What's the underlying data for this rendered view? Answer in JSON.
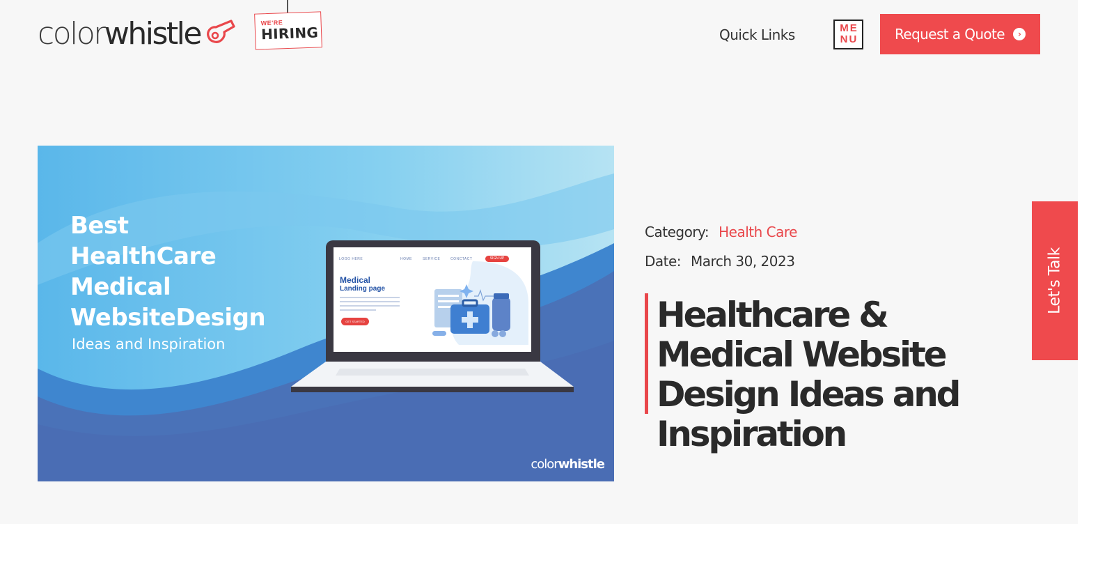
{
  "header": {
    "logo_light": "color",
    "logo_bold": "whistle",
    "hiring_small": "WE'RE",
    "hiring_big": "HIRING",
    "quick_links": "Quick Links",
    "menu_line1": "ME",
    "menu_line2": "NU",
    "quote_button": "Request a Quote",
    "icons": {
      "logo": "whistle-icon",
      "quote_arrow": "arrow-circle-right-icon"
    }
  },
  "hero": {
    "headline_lines": [
      "Best",
      "HealthCare",
      "Medical",
      "WebsiteDesign"
    ],
    "subline": "Ideas and Inspiration",
    "brand_light": "color",
    "brand_bold": "whistle",
    "screen": {
      "logo": "LOGO HERE",
      "nav": [
        "HOME",
        "SERVICE",
        "CONCTACT"
      ],
      "sign_up": "SIGN UP",
      "title1": "Medical",
      "title2": "Landing page",
      "cta": "GET STARTED"
    }
  },
  "meta": {
    "category_label": "Category:",
    "category_value": "Health Care",
    "date_label": "Date:",
    "date_value": "March 30, 2023"
  },
  "post": {
    "title": "Healthcare & Medical Website Design Ideas and Inspiration"
  },
  "side_tab": {
    "label": "Let's Talk"
  },
  "colors": {
    "accent": "#ef4a4d",
    "page_bg": "#f7f7f7",
    "text_dark": "#2a2a2a",
    "hero_blue": "#4a72b8"
  }
}
